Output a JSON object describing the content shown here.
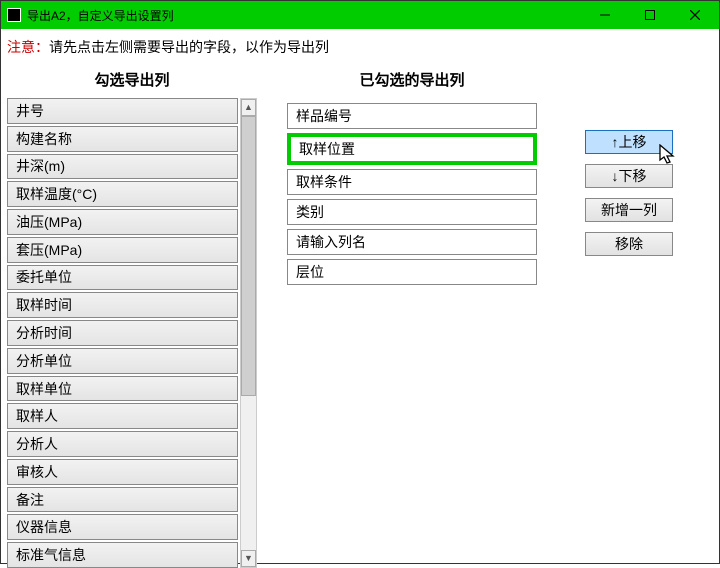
{
  "titlebar": {
    "title": "导出A2，自定义导出设置列"
  },
  "notice": {
    "label": "注意：",
    "text": "请先点击左侧需要导出的字段，以作为导出列"
  },
  "headers": {
    "left": "勾选导出列",
    "mid": "已勾选的导出列"
  },
  "leftFields": [
    "井号",
    "构建名称",
    "井深(m)",
    "取样温度(°C)",
    "油压(MPa)",
    "套压(MPa)",
    "委托单位",
    "取样时间",
    "分析时间",
    "分析单位",
    "取样单位",
    "取样人",
    "分析人",
    "审核人",
    "备注",
    "仪器信息",
    "标准气信息"
  ],
  "selectedFields": {
    "items": [
      "样品编号",
      "取样位置",
      "取样条件",
      "类别",
      "请输入列名",
      "层位"
    ],
    "highlightedIndex": 1
  },
  "actions": {
    "moveUp": "↑上移",
    "moveDown": "↓下移",
    "addCol": "新增一列",
    "remove": "移除"
  }
}
